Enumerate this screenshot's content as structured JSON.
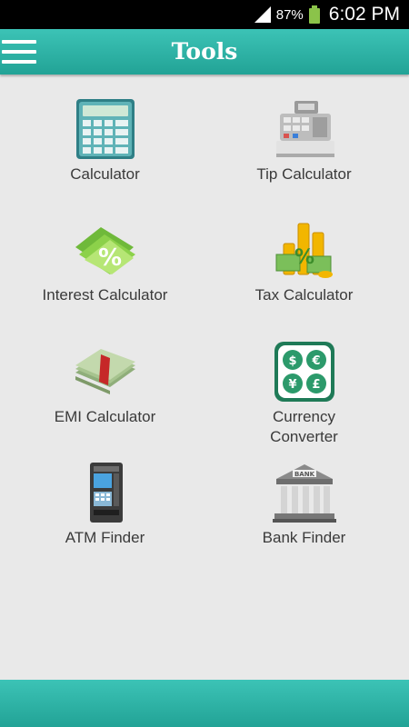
{
  "status_bar": {
    "battery_percent": "87%",
    "time": "6:02 PM"
  },
  "app_bar": {
    "title": "Tools",
    "menu_icon": "hamburger-menu-icon"
  },
  "tools": [
    {
      "label": "Calculator",
      "icon": "calculator-icon"
    },
    {
      "label": "Tip Calculator",
      "icon": "cash-register-icon"
    },
    {
      "label": "Interest Calculator",
      "icon": "percent-money-icon"
    },
    {
      "label": "Tax Calculator",
      "icon": "tax-coins-icon"
    },
    {
      "label": "EMI Calculator",
      "icon": "money-stack-icon"
    },
    {
      "label": "Currency Converter",
      "icon": "currency-symbols-icon"
    },
    {
      "label": "ATM Finder",
      "icon": "atm-machine-icon"
    },
    {
      "label": "Bank Finder",
      "icon": "bank-building-icon"
    }
  ],
  "icon_texts": {
    "bank_sign": "BANK"
  },
  "colors": {
    "app_bar": "#2db3a6",
    "background": "#e9e9e9",
    "label_text": "#3a3a3a"
  }
}
